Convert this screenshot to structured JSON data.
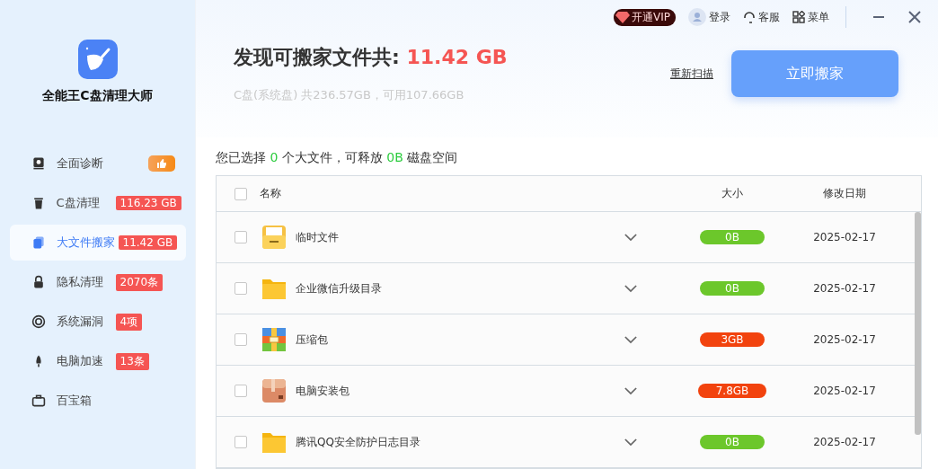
{
  "app": {
    "name": "全能王C盘清理大师"
  },
  "sidebar": {
    "items": [
      {
        "label": "全面诊断",
        "kind": "recommended",
        "selected": false
      },
      {
        "label": "C盘清理",
        "kind": "count",
        "badge": "116.23 GB",
        "selected": false
      },
      {
        "label": "大文件搬家",
        "kind": "count",
        "badge": "11.42 GB",
        "selected": true
      },
      {
        "label": "隐私清理",
        "kind": "count",
        "badge": "2070条",
        "selected": false
      },
      {
        "label": "系统漏洞",
        "kind": "count",
        "badge": "4项",
        "selected": false
      },
      {
        "label": "电脑加速",
        "kind": "count",
        "badge": "13条",
        "selected": false
      },
      {
        "label": "百宝箱",
        "kind": "plain",
        "selected": false
      }
    ]
  },
  "topbar": {
    "vip": "开通VIP",
    "login": "登录",
    "service": "客服",
    "menu": "菜单"
  },
  "header": {
    "title": "发现可搬家文件共: ",
    "total": "11.42 GB",
    "disk_info": "C盘(系统盘) 共236.57GB，可用107.66GB",
    "rescan": "重新扫描",
    "move_button": "立即搬家"
  },
  "selection": {
    "before": "您已选择 ",
    "count": "0",
    "middle": " 个大文件，可释放 ",
    "size": "0B",
    "after": " 磁盘空间"
  },
  "table": {
    "columns": [
      "名称",
      "大小",
      "修改日期"
    ],
    "header_checked": false,
    "rows": [
      {
        "name": "临时文件",
        "kind": "drawer",
        "size": "0B",
        "color": "#6cc72b",
        "date": "2025-02-17",
        "checked": false
      },
      {
        "name": "企业微信升级目录",
        "kind": "folder",
        "size": "0B",
        "color": "#6cc72b",
        "date": "2025-02-17",
        "checked": false
      },
      {
        "name": "压缩包",
        "kind": "archive",
        "size": "3GB",
        "color": "#f2430e",
        "date": "2025-02-17",
        "checked": false
      },
      {
        "name": "电脑安装包",
        "kind": "package",
        "size": "7.8GB",
        "color": "#f2430e",
        "date": "2025-02-17",
        "checked": false
      },
      {
        "name": "腾讯QQ安全防护日志目录",
        "kind": "folder",
        "size": "0B",
        "color": "#6cc72b",
        "date": "2025-02-17",
        "checked": false
      }
    ]
  }
}
